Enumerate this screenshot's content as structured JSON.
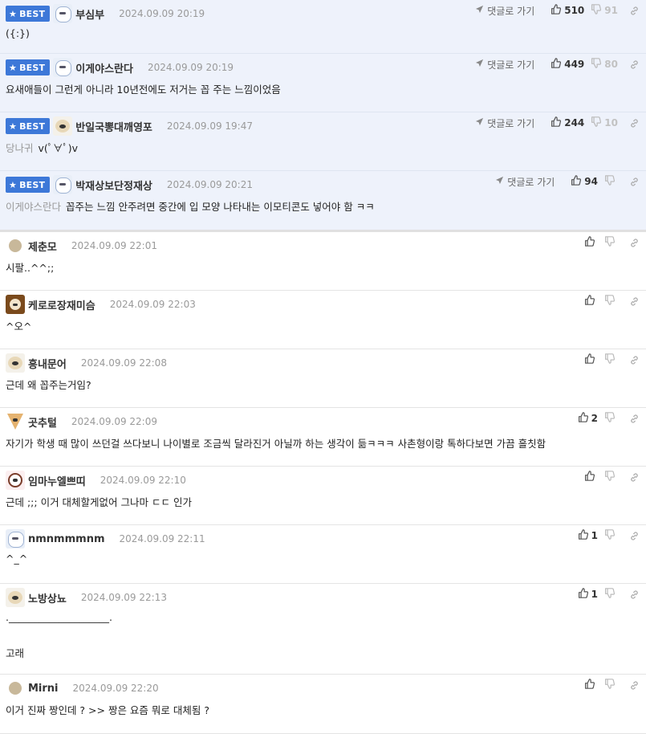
{
  "ui": {
    "best_label": "BEST",
    "reply_label": "댓글로 가기"
  },
  "comments": [
    {
      "best": true,
      "avatar": "cat",
      "nick": "부심부",
      "date": "2024.09.09 20:19",
      "ref": "",
      "lines": [
        "({:})"
      ],
      "up": "510",
      "down": "91",
      "h": 67
    },
    {
      "best": true,
      "avatar": "cat",
      "nick": "이게야스란다",
      "date": "2024.09.09 20:19",
      "ref": "",
      "lines": [
        "요새애들이 그런게 아니라 10년전에도 저거는 꼽 주는 느낌이었음"
      ],
      "up": "449",
      "down": "80",
      "h": 73
    },
    {
      "best": true,
      "avatar": "dog",
      "nick": "반일국뽕대깨영포",
      "date": "2024.09.09 19:47",
      "ref": "당나귀",
      "lines": [
        "v(ﾟ∀ﾟ)v"
      ],
      "up": "244",
      "down": "10",
      "h": 73
    },
    {
      "best": true,
      "last": true,
      "avatar": "cat",
      "nick": "박재상보단정재상",
      "date": "2024.09.09 20:21",
      "ref": "이게야스란다",
      "lines": [
        "꼽주는 느낌 안주려면 중간에 입 모양 나타내는 이모티콘도 넣어야 함 ㅋㅋ"
      ],
      "up": "94",
      "down": "",
      "h": 76
    },
    {
      "best": false,
      "avatar": "dot",
      "nick": "제춘모",
      "date": "2024.09.09 22:01",
      "ref": "",
      "lines": [
        "시팔..^^;;"
      ],
      "up": "",
      "down": "",
      "h": 73
    },
    {
      "best": false,
      "avatar": "lion",
      "nick": "케로로장재미슴",
      "date": "2024.09.09 22:03",
      "ref": "",
      "lines": [
        "^오^"
      ],
      "up": "",
      "down": "",
      "h": 73
    },
    {
      "best": false,
      "avatar": "dog",
      "nick": "흥내문어",
      "date": "2024.09.09 22:08",
      "ref": "",
      "lines": [
        "근데 왜 꼽주는거임?"
      ],
      "up": "",
      "down": "",
      "h": 73
    },
    {
      "best": false,
      "avatar": "fox",
      "nick": "곳추털",
      "date": "2024.09.09 22:09",
      "ref": "",
      "lines": [
        "자기가 학생 때 많이 쓰던걸 쓰다보니 나이별로 조금씩 달라진거 아닐까 하는 생각이 듦ㅋㅋㅋ 사촌형이랑 톡하다보면 가끔 흘칫함"
      ],
      "up": "2",
      "down": "",
      "h": 73
    },
    {
      "best": false,
      "avatar": "pup",
      "nick": "임마누엘쁘띠",
      "date": "2024.09.09 22:10",
      "ref": "",
      "lines": [
        "근데 ;;; 이거 대체할게없어 그나마 ㄷㄷ 인가"
      ],
      "up": "",
      "down": "",
      "h": 73
    },
    {
      "best": false,
      "avatar": "cat",
      "nick": "nmnmmmnm",
      "date": "2024.09.09 22:11",
      "ref": "",
      "lines": [
        "^_^"
      ],
      "up": "1",
      "down": "",
      "h": 73
    },
    {
      "best": false,
      "avatar": "dog",
      "nick": "노방상뇨",
      "date": "2024.09.09 22:13",
      "ref": "",
      "lines": [
        ".____________________.",
        "고래"
      ],
      "up": "1",
      "down": "",
      "h": 113
    },
    {
      "best": false,
      "avatar": "dot",
      "nick": "Mirni",
      "date": "2024.09.09 22:20",
      "ref": "",
      "lines": [
        "이거 진짜 짱인데 ? >> 짱은 요즘 뭐로 대체됨 ?"
      ],
      "up": "",
      "down": "",
      "h": 74
    }
  ]
}
